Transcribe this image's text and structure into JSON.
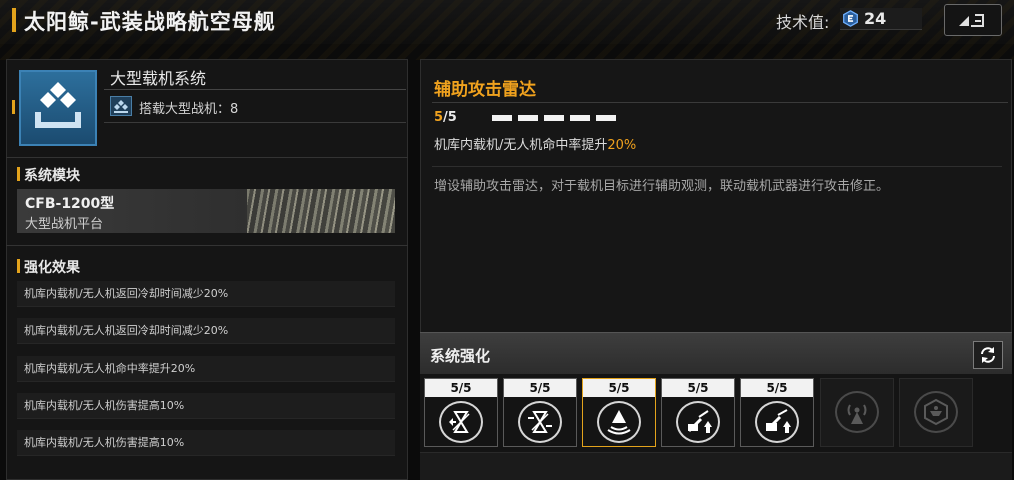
{
  "header": {
    "title": "太阳鲸-武装战略航空母舰",
    "tech_label": "技术值:",
    "tech_value": "24"
  },
  "system": {
    "name": "大型载机系统",
    "carrier_label": "搭载大型战机：",
    "carrier_count": "8"
  },
  "module_section": {
    "title": "系统模块",
    "code": "CFB-1200型",
    "desc": "大型战机平台"
  },
  "effects_section": {
    "title": "强化效果",
    "items": [
      "机库内载机/无人机返回冷却时间减少20%",
      "机库内载机/无人机返回冷却时间减少20%",
      "机库内载机/无人机命中率提升20%",
      "机库内载机/无人机伤害提高10%",
      "机库内载机/无人机伤害提高10%"
    ]
  },
  "detail": {
    "title": "辅助攻击雷达",
    "level_current": "5",
    "level_max": "/5",
    "level_bars": 5,
    "effect_prefix": "机库内载机/无人机命中率提升",
    "effect_value": "20%",
    "description": "增设辅助攻击雷达，对于载机目标进行辅助观测，联动载机武器进行攻击修正。"
  },
  "enhancement": {
    "title": "系统强化",
    "slots": [
      {
        "level": "5/5",
        "icon": "hourglass-return-icon",
        "locked": false,
        "selected": false
      },
      {
        "level": "5/5",
        "icon": "hourglass-cooldown-icon",
        "locked": false,
        "selected": false
      },
      {
        "level": "5/5",
        "icon": "radar-cone-icon",
        "locked": false,
        "selected": true
      },
      {
        "level": "5/5",
        "icon": "cannon-up-icon",
        "locked": false,
        "selected": false
      },
      {
        "level": "5/5",
        "icon": "cannon-up-alt-icon",
        "locked": false,
        "selected": false
      },
      {
        "icon": "signal-tower-icon",
        "locked": true,
        "selected": false
      },
      {
        "icon": "shield-drone-icon",
        "locked": true,
        "selected": false
      }
    ]
  },
  "colors": {
    "accent": "#f0a21e",
    "system_icon_bg": "#2d6f9c",
    "tech_icon": "#4a8fd6"
  }
}
